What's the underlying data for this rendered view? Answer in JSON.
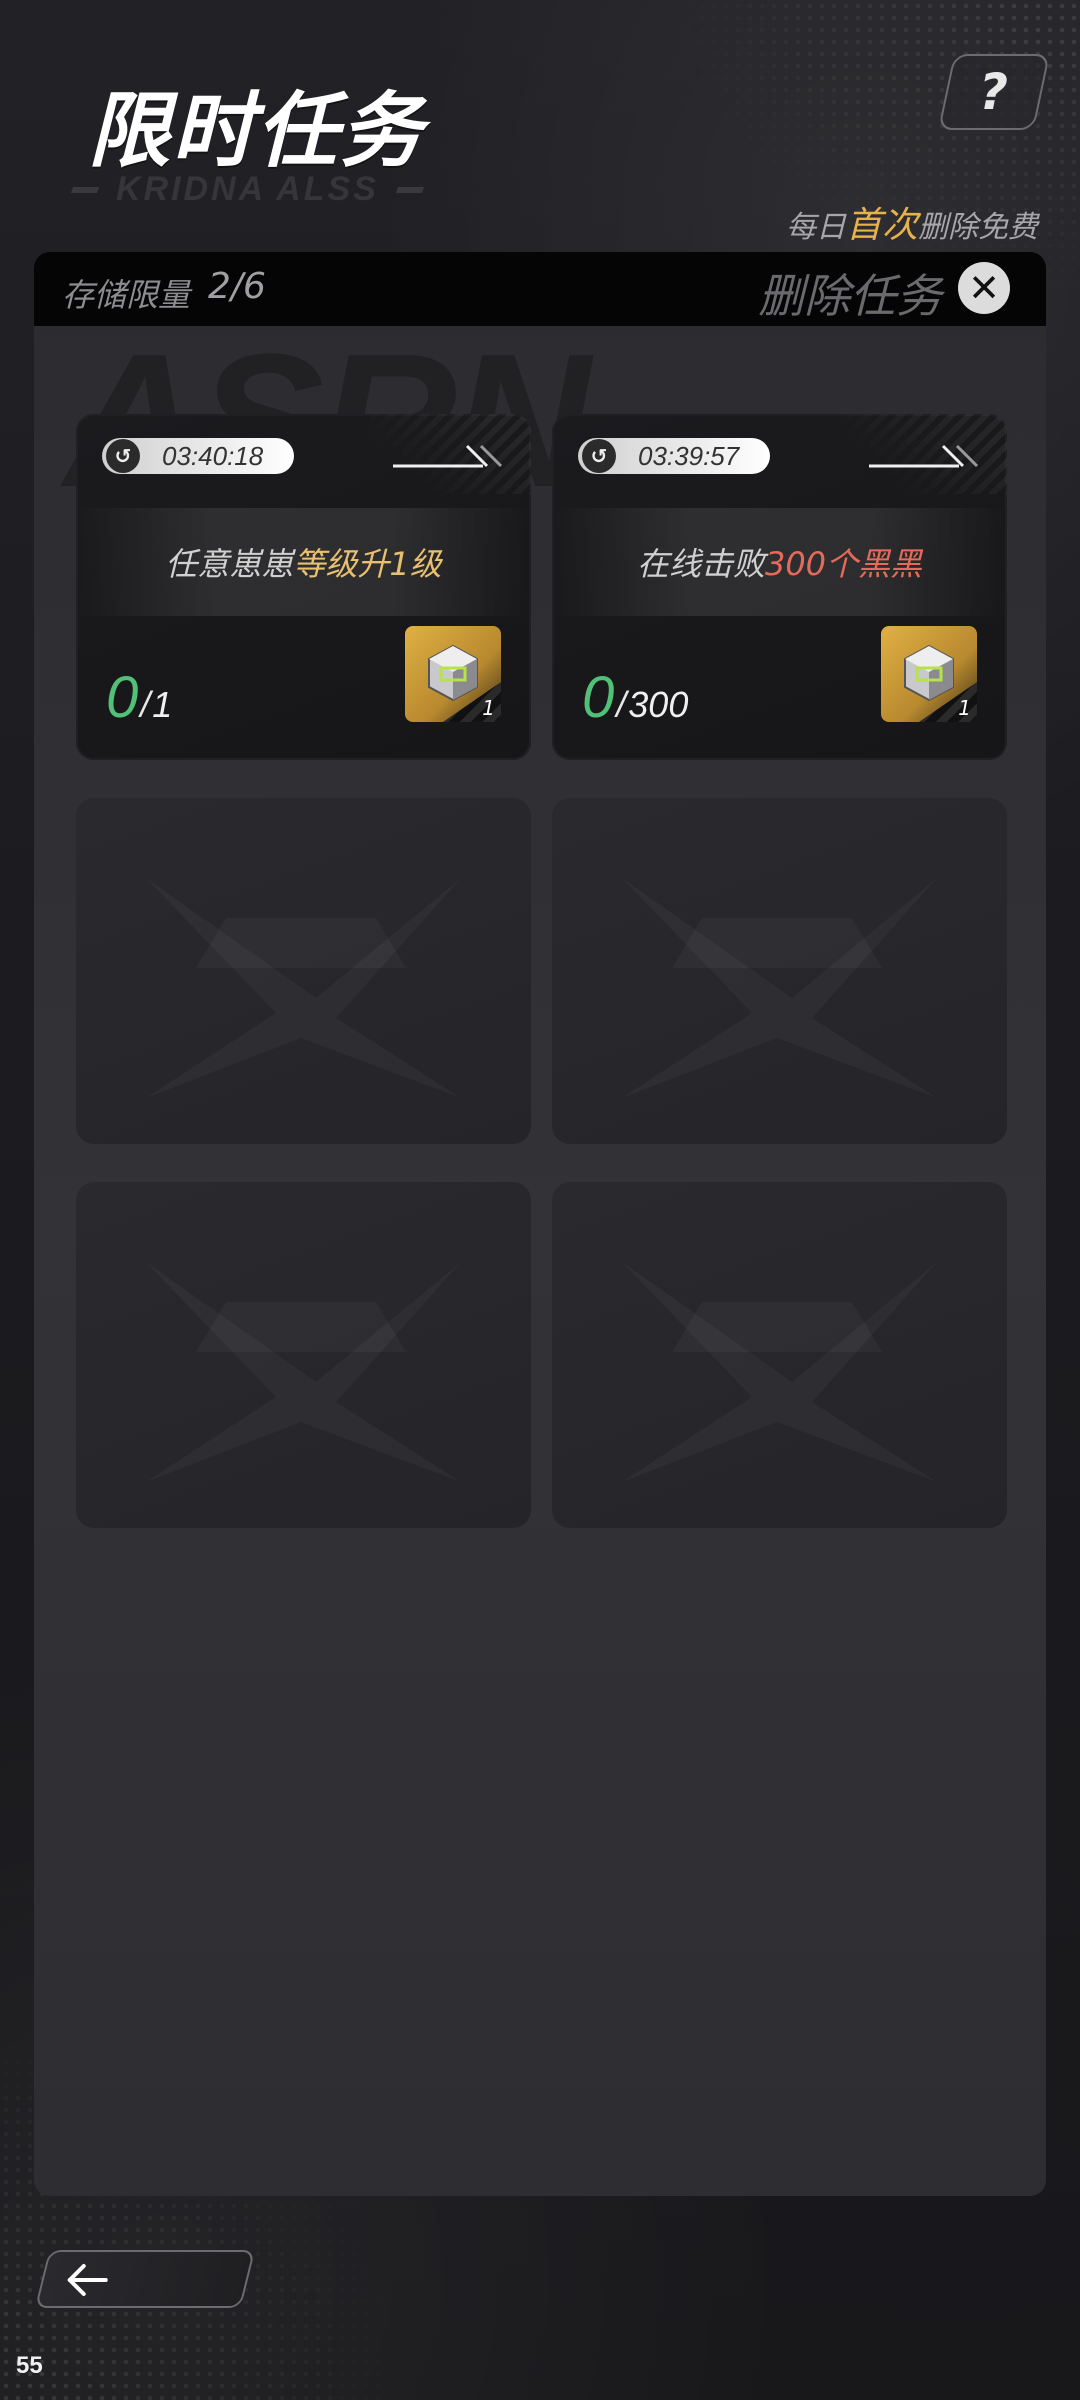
{
  "header": {
    "title": "限时任务",
    "subtitle": "KRIDNA ALSS",
    "help_icon": "help-icon"
  },
  "free_note": {
    "prefix": "每日",
    "highlight": "首次",
    "suffix": "删除免费",
    "highlight_color": "#e6b24a"
  },
  "panel": {
    "storage_label": "存储限量",
    "storage_value": "2/6",
    "delete_label": "删除任务",
    "close_icon": "close-icon",
    "watermark": "ASRN"
  },
  "tasks": [
    {
      "timer": "03:40:18",
      "task_prefix": "任意崽崽",
      "task_highlight": "等级升1级",
      "progress_current": "0",
      "progress_sep": "/",
      "progress_total": "1",
      "reward_count": "1",
      "highlight_color": "#e8c070"
    },
    {
      "timer": "03:39:57",
      "task_prefix": "在线击败",
      "task_highlight": "300个黑黑",
      "progress_current": "0",
      "progress_sep": "/",
      "progress_total": "300",
      "reward_count": "1",
      "highlight_color": "#e56a5a"
    }
  ],
  "empty_slots": 4,
  "footer": {
    "back_icon": "arrow-left-icon",
    "corner_number": "55"
  },
  "colors": {
    "progress_current": "#52c178",
    "reward_gold": "#e1b044",
    "background": "#1b1b1e"
  }
}
